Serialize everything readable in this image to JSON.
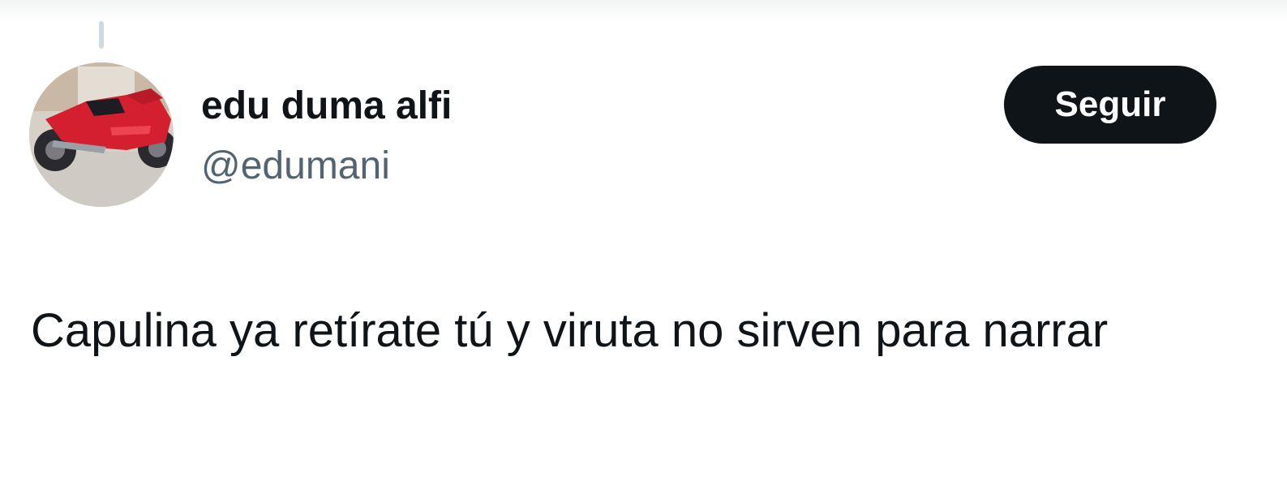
{
  "tweet": {
    "author": {
      "display_name": "edu duma alfi",
      "handle": "@edumani",
      "avatar_icon": "red-motorcycle-avatar"
    },
    "follow_button_label": "Seguir",
    "text": "Capulina ya retírate tú y viruta no sirven para narrar"
  },
  "colors": {
    "text_primary": "#0f1419",
    "text_secondary": "#536471",
    "button_bg": "#0f1419",
    "button_text": "#ffffff",
    "thread_line": "#cfd9de"
  }
}
